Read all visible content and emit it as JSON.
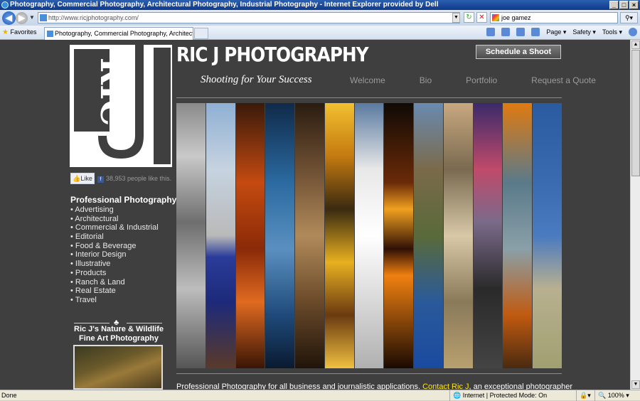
{
  "window": {
    "title": "Photography, Commercial Photography, Architectural Photography, Industrial Photography - Internet Explorer provided by Dell"
  },
  "browser": {
    "url": "http://www.ricjphotography.com/",
    "search_value": "joe gamez",
    "favorites_label": "Favorites",
    "tab_title": "Photography, Commercial Photography, Architectural ...",
    "page_menu": "Page",
    "safety_menu": "Safety",
    "tools_menu": "Tools"
  },
  "site": {
    "title": "RIC J PHOTOGRAPHY",
    "logo_text": "RIC",
    "schedule_button": "Schedule a Shoot",
    "tagline": "Shooting for Your Success",
    "nav": [
      "Welcome",
      "Bio",
      "Portfolio",
      "Request a Quote"
    ],
    "like_label": "Like",
    "like_count": "38,953 people like this.",
    "services_heading": "Professional Photography",
    "services": [
      "• Advertising",
      "• Architectural",
      "• Commercial & Industrial",
      "• Editorial",
      "• Food & Beverage",
      "• Interior Design",
      "• Illustrative",
      "• Products",
      "• Ranch & Land",
      "• Real Estate",
      "• Travel"
    ],
    "nature_line1": "Ric J's Nature & Wildlife",
    "nature_line2": "Fine Art Photography",
    "intro_text": "Professional Photography for all business and journalistic applications.",
    "intro_link": "Contact Ric J",
    "intro_tail": ", an exceptional photographer"
  },
  "strip_colors": [
    "linear-gradient(#8a8a8a,#c9c9c9 20%,#6e6e6e 45%,#bdbdbd 70%,#555 100%)",
    "linear-gradient(#8fb0d4,#c6d3e0 25%,#b9b9b9 50%,#2a3c9a 58%,#1d2a7a 75%,#5a3a2a 100%)",
    "linear-gradient(#3a1a0a,#c44a10 30%,#8a2a08 55%,#e06a20 75%,#3a1505 100%)",
    "linear-gradient(#0f2a4a,#2b6aa0 30%,#5a90c0 55%,#1e4a7a 80%,#0a1a30 100%)",
    "linear-gradient(#2a1c10,#7a5a3a 30%,#b08a5a 50%,#6a4a2a 75%,#20140a 100%)",
    "linear-gradient(#f2c030,#c47a10 20%,#3a2a10 40%,#e8b020 60%,#6a3a10 80%,#f0c040 100%)",
    "linear-gradient(#5a7aa0,#e8e8e8 25%,#ffffff 50%,#d8d8d8 75%,#b0b0b0 100%)",
    "linear-gradient(#100a05,#6a2a08 30%,#f0a020 40%,#301005 55%,#f08010 65%,#1a0a02 100%)",
    "linear-gradient(#6a8ab0,#7a6a4a 25%,#5a6a3a 50%,#2a5a9a 75%,#1a4aa0 100%)",
    "linear-gradient(#c8a880,#7a6a50 25%,#d8c8a8 50%,#8a7a5a 75%,#b8a070 100%)",
    "linear-gradient(#3a2a6a,#c04a6a 25%,#7a6a8a 45%,#2a2a2a 70%,#444 100%)",
    "linear-gradient(#e07a10,#5a7a8a 30%,#8aa0a8 55%,#c05a10 80%,#4a2a10 100%)",
    "linear-gradient(#2a5aa0,#3a6ab0 30%,#4a7ac0 50%,#b8b090 70%,#a0a070 100%)"
  ],
  "status": {
    "left": "Done",
    "zone": "Internet | Protected Mode: On",
    "zoom": "100%"
  }
}
